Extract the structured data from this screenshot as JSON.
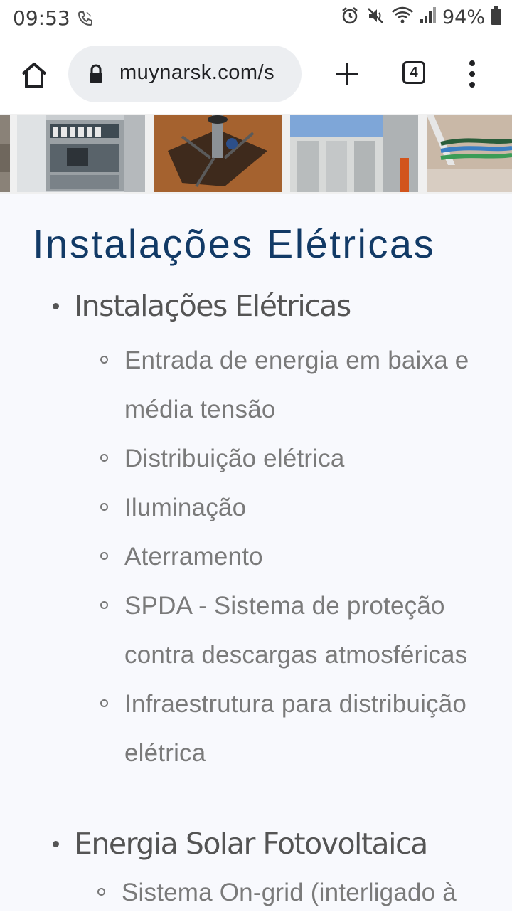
{
  "status_bar": {
    "time": "09:53",
    "battery": "94%"
  },
  "browser": {
    "url": "muynarsk.com/s",
    "tab_count": "4"
  },
  "page": {
    "title": "Instalações Elétricas",
    "sections": [
      {
        "title": "Instalações Elétricas",
        "items": [
          "Entrada de energia em baixa e média tensão",
          "Distribuição elétrica",
          "Iluminação",
          "Aterramento",
          "SPDA - Sistema de proteção contra descargas atmosféricas",
          "Infraestrutura para distribuição elétrica"
        ]
      },
      {
        "title": "Energia Solar Fotovoltaica",
        "items": [
          "Sistema On-grid (interligado à"
        ]
      }
    ]
  },
  "icons": {
    "home": "home-icon",
    "lock": "lock-icon",
    "new_tab": "plus-icon",
    "menu": "more-vert-icon"
  },
  "colors": {
    "title": "#123a66",
    "content_bg": "#f8f9fd"
  }
}
